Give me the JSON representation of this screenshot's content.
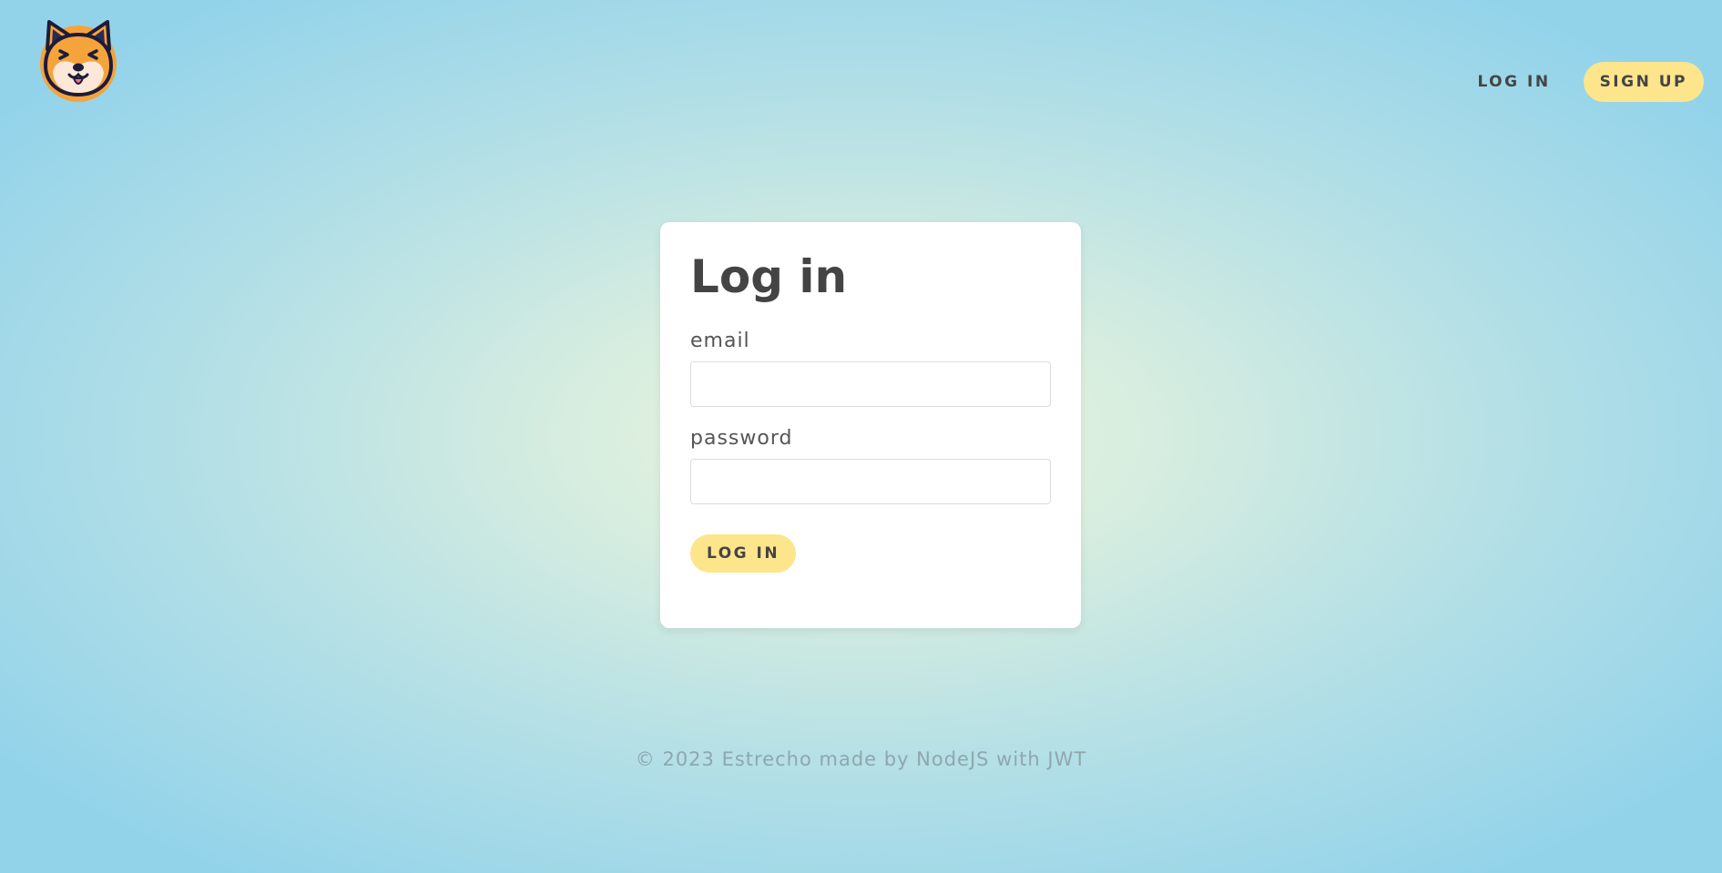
{
  "nav": {
    "login_label": "LOG IN",
    "signup_label": "SIGN UP"
  },
  "logo": {
    "icon": "shiba-dog-face-icon"
  },
  "form": {
    "title": "Log in",
    "email_label": "email",
    "email_value": "",
    "password_label": "password",
    "password_value": "",
    "submit_label": "LOG IN"
  },
  "footer": {
    "text": "© 2023 Estrecho made by NodeJS with JWT"
  },
  "colors": {
    "accent_button": "#fde58c",
    "text": "#444444",
    "card": "#ffffff",
    "logo_orange": "#f5a33b",
    "logo_outline": "#1c1c3a"
  }
}
